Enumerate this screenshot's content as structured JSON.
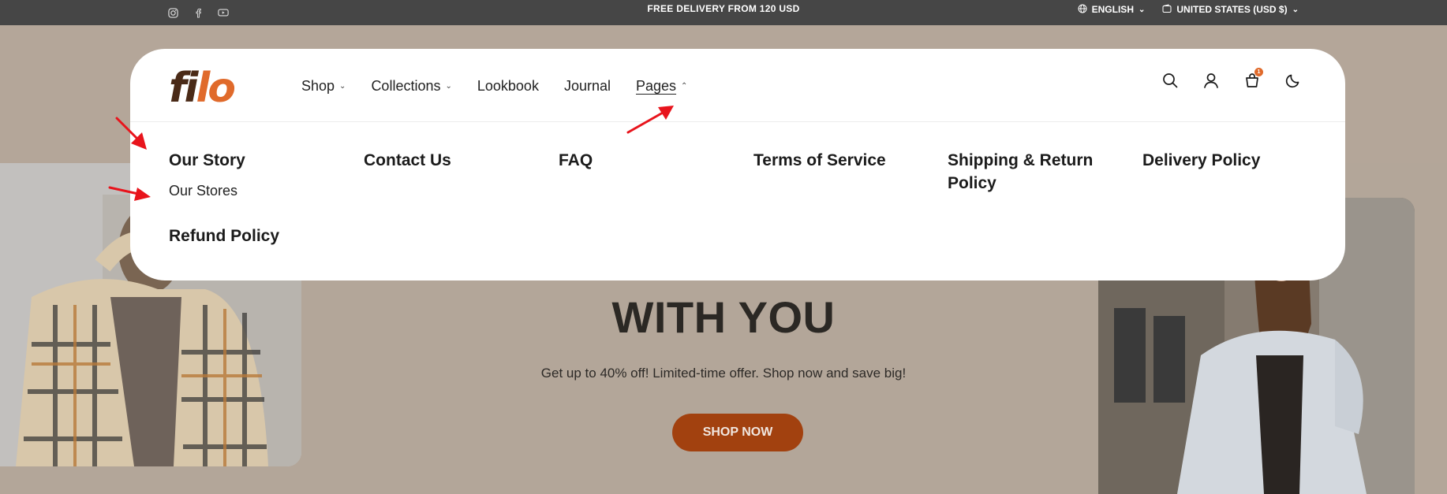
{
  "topbar": {
    "socials": [
      "instagram-icon",
      "facebook-icon",
      "youtube-icon"
    ],
    "announcement": "FREE DELIVERY FROM 120 USD",
    "language": "ENGLISH",
    "currency": "UNITED STATES (USD $)"
  },
  "header": {
    "logo_part1": "fi",
    "logo_part2": "lo",
    "nav": [
      {
        "label": "Shop",
        "has_dropdown": true
      },
      {
        "label": "Collections",
        "has_dropdown": true
      },
      {
        "label": "Lookbook",
        "has_dropdown": false
      },
      {
        "label": "Journal",
        "has_dropdown": false
      },
      {
        "label": "Pages",
        "has_dropdown": true,
        "active": true
      }
    ],
    "icons": [
      "search-icon",
      "account-icon",
      "cart-icon",
      "dark-mode-icon"
    ],
    "cart_count": "1"
  },
  "mega_menu": {
    "columns": [
      {
        "title": "Our Story",
        "sub": "Our Stores"
      },
      {
        "title": "Contact Us"
      },
      {
        "title": "FAQ"
      },
      {
        "title": "Terms of Service"
      },
      {
        "title": "Shipping & Return Policy"
      },
      {
        "title": "Delivery Policy"
      }
    ],
    "extra": "Refund Policy"
  },
  "hero": {
    "title": "WITH YOU",
    "subtitle": "Get up to 40% off! Limited-time offer. Shop now and save big!",
    "cta": "SHOP NOW"
  },
  "colors": {
    "accent": "#e06a2b",
    "button": "#a2410f",
    "topbar": "#464646",
    "annotation": "#e8141c"
  }
}
